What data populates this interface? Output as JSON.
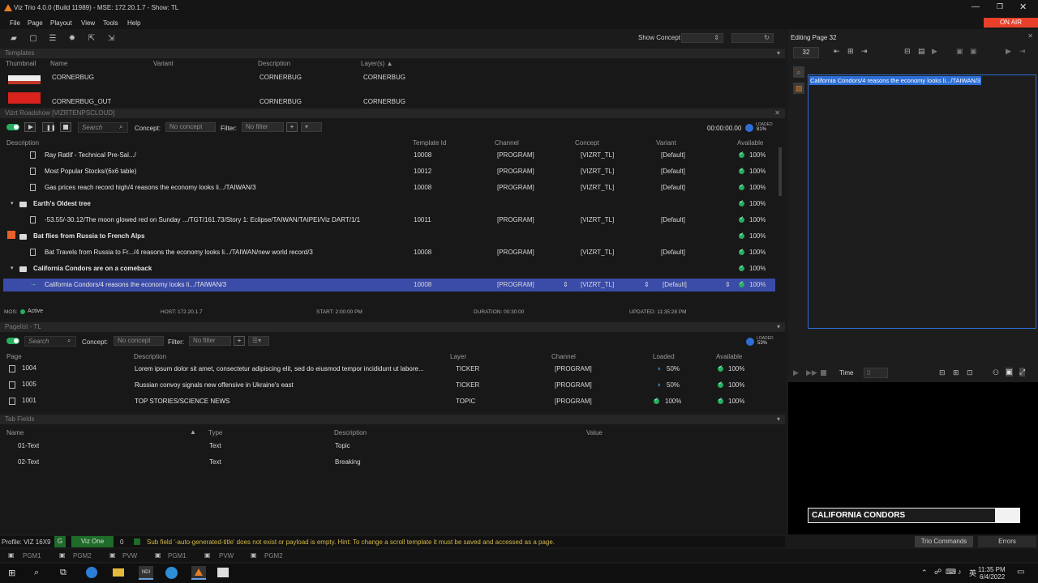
{
  "window": {
    "title": "Viz Trio 4.0.0 (Build 11989) - MSE: 172.20.1.7 - Show: TL",
    "on_air": "ON AIR"
  },
  "menu": [
    "File",
    "Page",
    "Playout",
    "View",
    "Tools",
    "Help"
  ],
  "toolbar": {
    "show_concept_label": "Show Concept"
  },
  "templates": {
    "title": "Templates",
    "columns": [
      "Thumbnail",
      "Name",
      "Variant",
      "Description",
      "Layer(s) ▲"
    ],
    "rows": [
      {
        "name": "CORNERBUG",
        "variant": "",
        "description": "CORNERBUG",
        "layers": "CORNERBUG"
      },
      {
        "name": "CORNERBUG_OUT",
        "variant": "",
        "description": "CORNERBUG",
        "layers": "CORNERBUG"
      }
    ]
  },
  "roadshow": {
    "title": "Vizrt Roadshow [VIZRTENPSCLOUD]",
    "search_placeholder": "Search",
    "concept_label": "Concept:",
    "concept_value": "No concept",
    "filter_label": "Filter:",
    "filter_value": "No filter",
    "timer": "00:00:00.00",
    "loaded_label": "LOADED",
    "loaded_value": "81%",
    "columns": [
      "Description",
      "Template Id",
      "Channel",
      "Concept",
      "Variant",
      "Available"
    ],
    "rows": [
      {
        "indent": 2,
        "kind": "item",
        "description": "Ray Ratlif - Technical Pre-Sal.../",
        "template_id": "10008",
        "channel": "[PROGRAM]",
        "concept": "[VIZRT_TL]",
        "variant": "[Default]",
        "available": "100%"
      },
      {
        "indent": 2,
        "kind": "item",
        "description": "Most Popular Stocks/(6x6 table)",
        "template_id": "10012",
        "channel": "[PROGRAM]",
        "concept": "[VIZRT_TL]",
        "variant": "[Default]",
        "available": "100%"
      },
      {
        "indent": 2,
        "kind": "item",
        "description": "Gas prices reach record high/4 reasons the economy looks li.../TAIWAN/3",
        "template_id": "10008",
        "channel": "[PROGRAM]",
        "concept": "[VIZRT_TL]",
        "variant": "[Default]",
        "available": "100%"
      },
      {
        "indent": 1,
        "kind": "folder",
        "description": "Earth's Oldest tree",
        "template_id": "",
        "channel": "",
        "concept": "",
        "variant": "",
        "available": "100%"
      },
      {
        "indent": 2,
        "kind": "item",
        "description": "-53.55/-30.12/The moon glowed red on Sunday .../TGT/161.73/Story 1: Eclipse/TAIWAN/TAIPEI/Viz DART/1/1",
        "template_id": "10011",
        "channel": "[PROGRAM]",
        "concept": "[VIZRT_TL]",
        "variant": "[Default]",
        "available": "100%"
      },
      {
        "indent": 1,
        "kind": "folder-flag",
        "description": "Bat flies from Russia to French Alps",
        "template_id": "",
        "channel": "",
        "concept": "",
        "variant": "",
        "available": "100%"
      },
      {
        "indent": 2,
        "kind": "item",
        "description": "Bat Travels  from Russia to Fr.../4 reasons the economy looks li.../TAIWAN/new world record/3",
        "template_id": "10008",
        "channel": "[PROGRAM]",
        "concept": "[VIZRT_TL]",
        "variant": "[Default]",
        "available": "100%"
      },
      {
        "indent": 1,
        "kind": "folder",
        "description": "California Condors are on a comeback",
        "template_id": "",
        "channel": "",
        "concept": "",
        "variant": "",
        "available": "100%"
      },
      {
        "indent": 2,
        "kind": "selected",
        "description": "California Condors/4 reasons the economy looks li.../TAIWAN/3",
        "template_id": "10008",
        "channel": "[PROGRAM]",
        "concept": "[VIZRT_TL]",
        "variant": "[Default]",
        "available": "100%"
      }
    ],
    "status": {
      "mos": "MOS:",
      "mos_state": "Active",
      "host": "HOST: 172.20.1.7",
      "start": "START: 2:00:00 PM",
      "duration": "DURATION: 00:30:00",
      "updated": "UPDATED: 11:35:28 PM"
    }
  },
  "pagelist": {
    "title": "Pagelist - TL",
    "search_placeholder": "Search",
    "concept_label": "Concept:",
    "concept_value": "No concept",
    "filter_label": "Filter:",
    "filter_value": "No filter",
    "loaded_label": "LOADED",
    "loaded_value": "53%",
    "columns": [
      "Page",
      "Description",
      "Layer",
      "Channel",
      "Loaded",
      "Available"
    ],
    "rows": [
      {
        "page": "1004",
        "description": "Lorem ipsum dolor sit amet, consectetur adipiscing elit, sed do eiusmod tempor incididunt ut labore...",
        "layer": "TICKER",
        "channel": "[PROGRAM]",
        "loaded": "50%",
        "loaded_state": "partial",
        "available": "100%"
      },
      {
        "page": "1005",
        "description": "Russian convoy signals new offensive in Ukraine's east",
        "layer": "TICKER",
        "channel": "[PROGRAM]",
        "loaded": "50%",
        "loaded_state": "partial",
        "available": "100%"
      },
      {
        "page": "1001",
        "description": "TOP STORIES/SCIENCE NEWS",
        "layer": "TOPIC",
        "channel": "[PROGRAM]",
        "loaded": "100%",
        "loaded_state": "full",
        "available": "100%"
      }
    ]
  },
  "tab_fields": {
    "title": "Tab Fields",
    "columns": [
      "Name",
      "Type",
      "Description",
      "Value"
    ],
    "rows": [
      {
        "name": "01-Text",
        "type": "Text",
        "description": "Topic",
        "value": ""
      },
      {
        "name": "02-Text",
        "type": "Text",
        "description": "Breaking",
        "value": ""
      }
    ]
  },
  "editor": {
    "title": "Editing Page 32",
    "page_number": "32",
    "text": "California Condors/4 reasons the economy looks li.../TAIWAN/3",
    "time_label": "Time",
    "time_value": "0",
    "preview_text": "CALIFORNIA CONDORS",
    "trio_commands": "Trio Commands",
    "errors": "Errors"
  },
  "statusbar": {
    "profile": "Profile: VIZ 16X9",
    "g": "G",
    "viz_one": "Viz One",
    "count": "0",
    "message": "Sub field '-auto-generated-title' does not exist or payload is empty. Hint: To change a scroll template it must be saved and accessed as a page."
  },
  "outputs": [
    "PGM1",
    "PGM2",
    "PVW",
    "PGM1",
    "PVW",
    "PGM2"
  ],
  "system_tray": {
    "time": "11:35 PM",
    "date": "6/4/2022"
  },
  "colors": {
    "accent": "#3a4ba8",
    "on_air": "#e8402a",
    "green": "#27ae60",
    "highlight": "#2d6fd6"
  }
}
